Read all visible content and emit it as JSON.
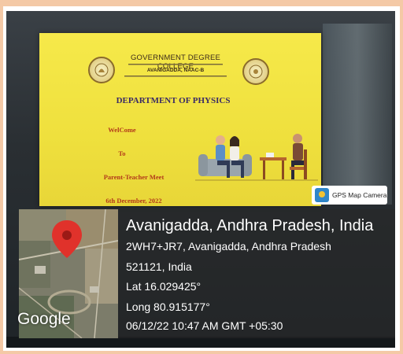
{
  "slide": {
    "college_name": "GOVERNMENT DEGREE COLLEGE",
    "campus": "AVANIGADDA, NAAC-B",
    "department": "DEPARTMENT OF PHYSICS",
    "welcome": "WelCome",
    "to": "To",
    "event": "Parent-Teacher Meet",
    "date": "6th December, 2022"
  },
  "gps": {
    "app_label": "GPS Map Camera",
    "map_brand": "Google",
    "place": "Avanigadda, Andhra Pradesh, India",
    "address_line1": "2WH7+JR7, Avanigadda, Andhra Pradesh",
    "address_line2": "521121, India",
    "latitude": "Lat 16.029425°",
    "longitude": "Long 80.915177°",
    "timestamp": "06/12/22 10:47 AM GMT +05:30"
  },
  "colors": {
    "slide_background": "#f2e244",
    "slide_title": "#3a2a66",
    "slide_text": "#b33a1a",
    "map_pin": "#e0322b",
    "overlay_text": "#ffffff"
  },
  "icons": {
    "map_pin": "location-pin-icon",
    "gps_app": "gps-camera-icon"
  }
}
